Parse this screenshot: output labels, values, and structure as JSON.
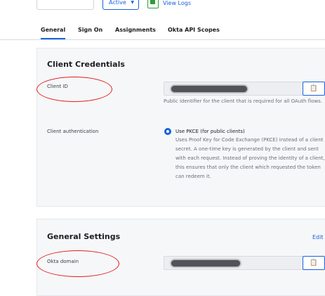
{
  "header": {
    "status_label": "Active",
    "status_caret": "▼",
    "view_logs_label": "View Logs"
  },
  "tabs": [
    {
      "label": "General"
    },
    {
      "label": "Sign On"
    },
    {
      "label": "Assignments"
    },
    {
      "label": "Okta API Scopes"
    }
  ],
  "client_credentials": {
    "title": "Client Credentials",
    "client_id_label": "Client ID",
    "client_id_help": "Public identifier for the client that is required for all OAuth flows.",
    "client_auth_label": "Client authentication",
    "pkce_option_label": "Use PKCE (for public clients)",
    "pkce_description": "Uses Proof Key for Code Exchange (PKCE) instead of a client secret. A one-time key is generated by the client and sent with each request. Instead of proving the identity of a client, this ensures that only the client which requested the token can redeem it."
  },
  "general_settings": {
    "title": "General Settings",
    "edit_label": "Edit",
    "okta_domain_label": "Okta domain"
  },
  "colors": {
    "accent": "#1662dd",
    "annotation": "#e21d1d",
    "success": "#2d9c3a"
  }
}
